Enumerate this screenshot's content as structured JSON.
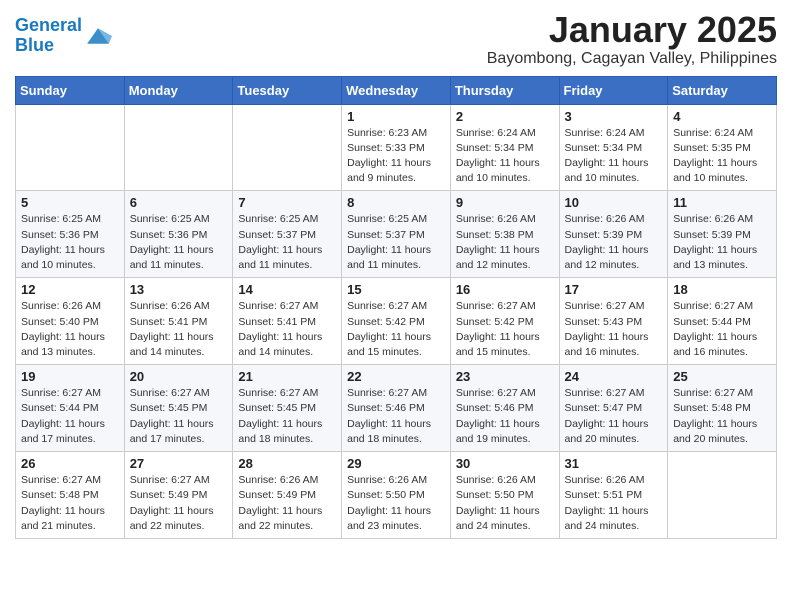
{
  "header": {
    "logo_line1": "General",
    "logo_line2": "Blue",
    "month": "January 2025",
    "location": "Bayombong, Cagayan Valley, Philippines"
  },
  "days_of_week": [
    "Sunday",
    "Monday",
    "Tuesday",
    "Wednesday",
    "Thursday",
    "Friday",
    "Saturday"
  ],
  "weeks": [
    [
      {
        "day": "",
        "info": ""
      },
      {
        "day": "",
        "info": ""
      },
      {
        "day": "",
        "info": ""
      },
      {
        "day": "1",
        "info": "Sunrise: 6:23 AM\nSunset: 5:33 PM\nDaylight: 11 hours\nand 9 minutes."
      },
      {
        "day": "2",
        "info": "Sunrise: 6:24 AM\nSunset: 5:34 PM\nDaylight: 11 hours\nand 10 minutes."
      },
      {
        "day": "3",
        "info": "Sunrise: 6:24 AM\nSunset: 5:34 PM\nDaylight: 11 hours\nand 10 minutes."
      },
      {
        "day": "4",
        "info": "Sunrise: 6:24 AM\nSunset: 5:35 PM\nDaylight: 11 hours\nand 10 minutes."
      }
    ],
    [
      {
        "day": "5",
        "info": "Sunrise: 6:25 AM\nSunset: 5:36 PM\nDaylight: 11 hours\nand 10 minutes."
      },
      {
        "day": "6",
        "info": "Sunrise: 6:25 AM\nSunset: 5:36 PM\nDaylight: 11 hours\nand 11 minutes."
      },
      {
        "day": "7",
        "info": "Sunrise: 6:25 AM\nSunset: 5:37 PM\nDaylight: 11 hours\nand 11 minutes."
      },
      {
        "day": "8",
        "info": "Sunrise: 6:25 AM\nSunset: 5:37 PM\nDaylight: 11 hours\nand 11 minutes."
      },
      {
        "day": "9",
        "info": "Sunrise: 6:26 AM\nSunset: 5:38 PM\nDaylight: 11 hours\nand 12 minutes."
      },
      {
        "day": "10",
        "info": "Sunrise: 6:26 AM\nSunset: 5:39 PM\nDaylight: 11 hours\nand 12 minutes."
      },
      {
        "day": "11",
        "info": "Sunrise: 6:26 AM\nSunset: 5:39 PM\nDaylight: 11 hours\nand 13 minutes."
      }
    ],
    [
      {
        "day": "12",
        "info": "Sunrise: 6:26 AM\nSunset: 5:40 PM\nDaylight: 11 hours\nand 13 minutes."
      },
      {
        "day": "13",
        "info": "Sunrise: 6:26 AM\nSunset: 5:41 PM\nDaylight: 11 hours\nand 14 minutes."
      },
      {
        "day": "14",
        "info": "Sunrise: 6:27 AM\nSunset: 5:41 PM\nDaylight: 11 hours\nand 14 minutes."
      },
      {
        "day": "15",
        "info": "Sunrise: 6:27 AM\nSunset: 5:42 PM\nDaylight: 11 hours\nand 15 minutes."
      },
      {
        "day": "16",
        "info": "Sunrise: 6:27 AM\nSunset: 5:42 PM\nDaylight: 11 hours\nand 15 minutes."
      },
      {
        "day": "17",
        "info": "Sunrise: 6:27 AM\nSunset: 5:43 PM\nDaylight: 11 hours\nand 16 minutes."
      },
      {
        "day": "18",
        "info": "Sunrise: 6:27 AM\nSunset: 5:44 PM\nDaylight: 11 hours\nand 16 minutes."
      }
    ],
    [
      {
        "day": "19",
        "info": "Sunrise: 6:27 AM\nSunset: 5:44 PM\nDaylight: 11 hours\nand 17 minutes."
      },
      {
        "day": "20",
        "info": "Sunrise: 6:27 AM\nSunset: 5:45 PM\nDaylight: 11 hours\nand 17 minutes."
      },
      {
        "day": "21",
        "info": "Sunrise: 6:27 AM\nSunset: 5:45 PM\nDaylight: 11 hours\nand 18 minutes."
      },
      {
        "day": "22",
        "info": "Sunrise: 6:27 AM\nSunset: 5:46 PM\nDaylight: 11 hours\nand 18 minutes."
      },
      {
        "day": "23",
        "info": "Sunrise: 6:27 AM\nSunset: 5:46 PM\nDaylight: 11 hours\nand 19 minutes."
      },
      {
        "day": "24",
        "info": "Sunrise: 6:27 AM\nSunset: 5:47 PM\nDaylight: 11 hours\nand 20 minutes."
      },
      {
        "day": "25",
        "info": "Sunrise: 6:27 AM\nSunset: 5:48 PM\nDaylight: 11 hours\nand 20 minutes."
      }
    ],
    [
      {
        "day": "26",
        "info": "Sunrise: 6:27 AM\nSunset: 5:48 PM\nDaylight: 11 hours\nand 21 minutes."
      },
      {
        "day": "27",
        "info": "Sunrise: 6:27 AM\nSunset: 5:49 PM\nDaylight: 11 hours\nand 22 minutes."
      },
      {
        "day": "28",
        "info": "Sunrise: 6:26 AM\nSunset: 5:49 PM\nDaylight: 11 hours\nand 22 minutes."
      },
      {
        "day": "29",
        "info": "Sunrise: 6:26 AM\nSunset: 5:50 PM\nDaylight: 11 hours\nand 23 minutes."
      },
      {
        "day": "30",
        "info": "Sunrise: 6:26 AM\nSunset: 5:50 PM\nDaylight: 11 hours\nand 24 minutes."
      },
      {
        "day": "31",
        "info": "Sunrise: 6:26 AM\nSunset: 5:51 PM\nDaylight: 11 hours\nand 24 minutes."
      },
      {
        "day": "",
        "info": ""
      }
    ]
  ]
}
